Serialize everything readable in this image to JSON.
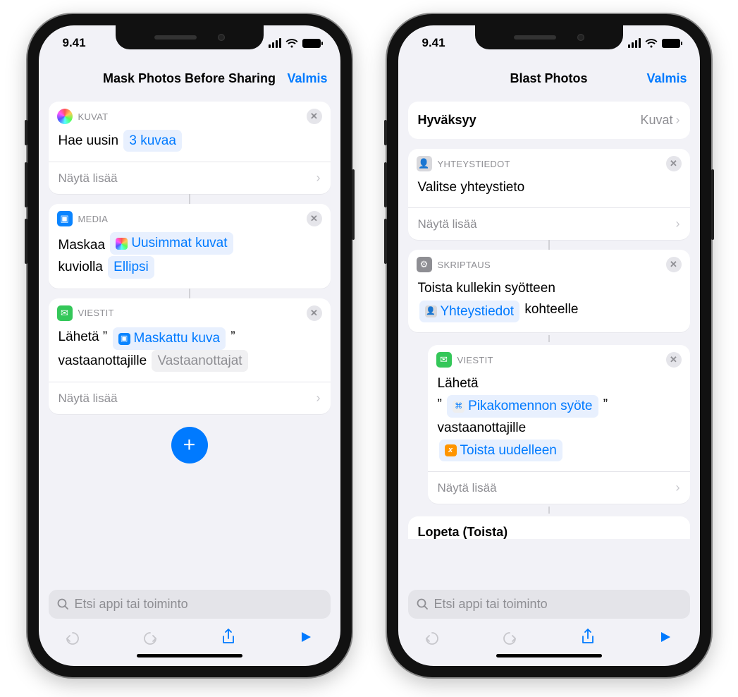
{
  "status": {
    "time": "9.41"
  },
  "nav": {
    "done": "Valmis"
  },
  "phone_left": {
    "title": "Mask Photos Before Sharing",
    "cards": {
      "photos": {
        "label": "KUVAT",
        "line_prefix": "Hae uusin",
        "token": "3 kuvaa",
        "show_more": "Näytä lisää"
      },
      "media": {
        "label": "MEDIA",
        "line1_prefix": "Maskaa",
        "token1": "Uusimmat kuvat",
        "line2_prefix": "kuviolla",
        "token2": "Ellipsi"
      },
      "messages": {
        "label": "VIESTIT",
        "line1_prefix": "Lähetä ”",
        "token1": "Maskattu kuva",
        "line1_suffix": "”",
        "line2_prefix": "vastaanottajille",
        "token2": "Vastaanottajat",
        "show_more": "Näytä lisää"
      }
    }
  },
  "phone_right": {
    "title": "Blast Photos",
    "accepts": {
      "key": "Hyväksyy",
      "value": "Kuvat"
    },
    "cards": {
      "contacts": {
        "label": "YHTEYSTIEDOT",
        "line": "Valitse yhteystieto",
        "show_more": "Näytä lisää"
      },
      "script": {
        "label": "SKRIPTAUS",
        "line1": "Toista kullekin syötteen",
        "token": "Yhteystiedot",
        "line2_suffix": "kohteelle"
      },
      "messages": {
        "label": "VIESTIT",
        "line1": "Lähetä",
        "quote_open": "”",
        "token1": "Pikakomennon syöte",
        "quote_close": "”",
        "line3": "vastaanottajille",
        "token2": "Toista uudelleen",
        "show_more": "Näytä lisää"
      },
      "partial": "Lopeta (Toista)"
    }
  },
  "search": {
    "placeholder": "Etsi appi tai toiminto"
  }
}
